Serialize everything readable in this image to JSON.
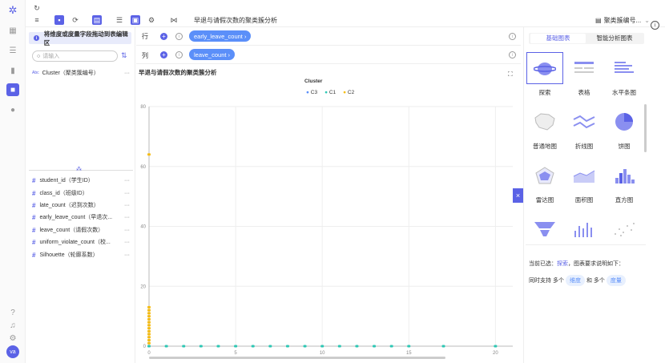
{
  "toolbar": {
    "title": "早退与请假次数的聚类簇分析",
    "dataset": "聚类簇编号..."
  },
  "left_panel": {
    "hint": "将维度或度量字段拖动到表编辑区",
    "search_placeholder": "请输入",
    "dimension": {
      "type": "Abc",
      "label": "Cluster（聚类簇编号）"
    },
    "measures": [
      "student_id（学生ID）",
      "class_id（班级ID）",
      "late_count（迟到次数）",
      "early_leave_count（早退次...",
      "leave_count（请假次数）",
      "uniform_violate_count（校...",
      "Silhouette（轮廓系数）"
    ]
  },
  "shelves": {
    "row_label": "行",
    "row_field": "early_leave_count ›",
    "col_label": "列",
    "col_field": "leave_count ›"
  },
  "chart_data": {
    "type": "scatter",
    "title": "早退与请假次数的聚类簇分析",
    "legend_title": "Cluster",
    "series": [
      {
        "name": "C3",
        "color": "#5b8ff9",
        "points": []
      },
      {
        "name": "C1",
        "color": "#2ec7b4",
        "points": [
          [
            0,
            0
          ],
          [
            1,
            0
          ],
          [
            2,
            0
          ],
          [
            3,
            0
          ],
          [
            4,
            0
          ],
          [
            5,
            0
          ],
          [
            6,
            0
          ],
          [
            7,
            0
          ],
          [
            8,
            0
          ],
          [
            9,
            0
          ],
          [
            10,
            0
          ],
          [
            11,
            0
          ],
          [
            12,
            0
          ],
          [
            13,
            0
          ],
          [
            14,
            0
          ],
          [
            15,
            0
          ],
          [
            17,
            0
          ],
          [
            20,
            0
          ]
        ]
      },
      {
        "name": "C2",
        "color": "#f6bd16",
        "points": [
          [
            0,
            64
          ],
          [
            0,
            13
          ],
          [
            0,
            12
          ],
          [
            0,
            11
          ],
          [
            0,
            10
          ],
          [
            0,
            9
          ],
          [
            0,
            8
          ],
          [
            0,
            7
          ],
          [
            0,
            6
          ],
          [
            0,
            5
          ],
          [
            0,
            4
          ],
          [
            0,
            3
          ],
          [
            0,
            2
          ],
          [
            0,
            1
          ]
        ]
      }
    ],
    "x_ticks": [
      "0",
      "5",
      "10",
      "15",
      "20"
    ],
    "y_ticks": [
      "0",
      "20",
      "40",
      "60",
      "80"
    ],
    "xlim": [
      0,
      21
    ],
    "ylim": [
      0,
      80
    ]
  },
  "right_panel": {
    "tabs": [
      "基础图表",
      "智能分析图表"
    ],
    "charts": [
      "探索",
      "表格",
      "水平条图",
      "普通地图",
      "折线图",
      "饼图",
      "雷达图",
      "面积图",
      "直方图",
      "",
      "",
      ""
    ],
    "status_prefix": "当前已选：",
    "status_sel": "探索",
    "status_suffix": "，图表要求说明如下：",
    "support_a": "同时支持 多个",
    "dim": "维度",
    "support_b": "和 多个",
    "measure": "度量"
  },
  "user": {
    "avatar": "va"
  },
  "colors": {
    "accent": "#5b62e6",
    "blue": "#5b8ff9"
  }
}
